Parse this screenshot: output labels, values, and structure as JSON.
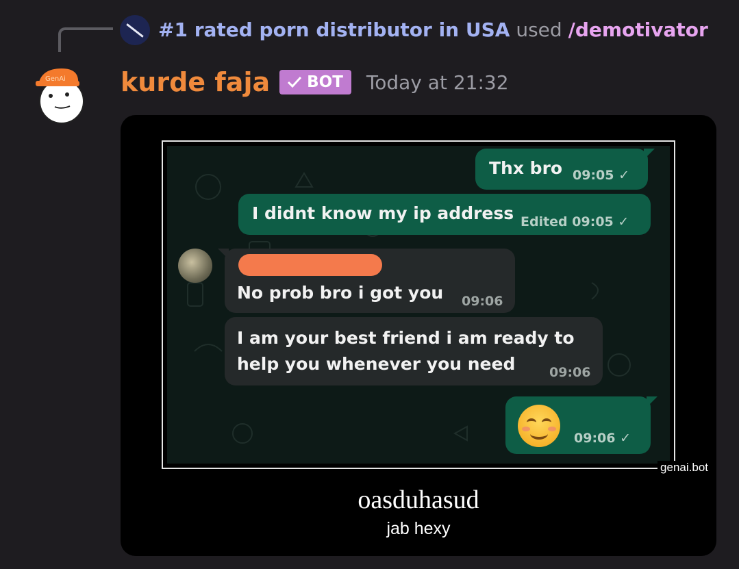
{
  "reply": {
    "username": "#1 rated porn distributor in USA",
    "used_text": "used",
    "command": "/demotivator"
  },
  "message": {
    "username": "kurde faja",
    "badge": "BOT",
    "timestamp": "Today at 21:32",
    "avatar_hat_text": "GenAi"
  },
  "embed": {
    "chat": {
      "messages": [
        {
          "direction": "out",
          "text": "Thx bro",
          "time": "09:05"
        },
        {
          "direction": "out",
          "text": "I didnt know my ip address",
          "edited": "Edited",
          "time": "09:05"
        },
        {
          "direction": "in",
          "text": "No prob bro i got you",
          "time": "09:06"
        },
        {
          "direction": "in",
          "line1": "I am your best friend i am ready to",
          "line2": "help you whenever you need",
          "time": "09:06"
        },
        {
          "direction": "out",
          "emoji": "smiling-face",
          "time": "09:06"
        }
      ]
    },
    "watermark": "genai.bot",
    "title": "oasduhasud",
    "subtitle": "jab hexy"
  },
  "colors": {
    "background": "#1e1c20",
    "username": "#f08a3c",
    "bot_badge": "#c07bd0",
    "reply_user": "#a3b2f2",
    "command": "#e7a4ef",
    "outgoing_bubble": "#0e5d46",
    "incoming_bubble": "#25292a"
  }
}
